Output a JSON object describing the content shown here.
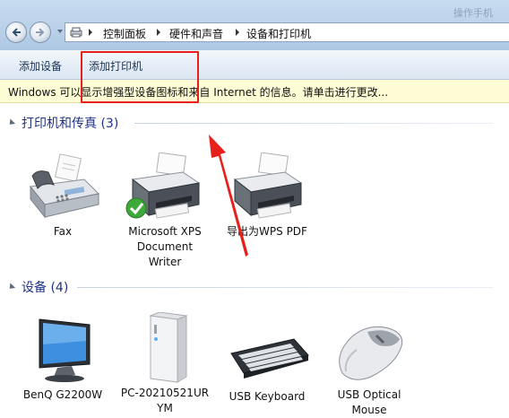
{
  "window": {
    "title": "操作手机"
  },
  "address": {
    "crumbs": [
      "控制面板",
      "硬件和声音",
      "设备和打印机"
    ]
  },
  "toolbar": {
    "add_device": "添加设备",
    "add_printer": "添加打印机"
  },
  "infobar": {
    "message": "Windows 可以显示增强型设备图标和来自 Internet 的信息。请单击进行更改..."
  },
  "groups": {
    "printers": {
      "title": "打印机和传真 (3)",
      "items": [
        {
          "label1": "Fax",
          "label2": "",
          "label3": "",
          "icon": "fax-icon"
        },
        {
          "label1": "Microsoft XPS",
          "label2": "Document",
          "label3": "Writer",
          "icon": "printer-icon",
          "default": true
        },
        {
          "label1": "导出为WPS PDF",
          "label2": "",
          "label3": "",
          "icon": "printer-icon"
        }
      ]
    },
    "devices": {
      "title": "设备 (4)",
      "items": [
        {
          "label1": "BenQ G2200W",
          "label2": "",
          "icon": "monitor-icon"
        },
        {
          "label1": "PC-20210521UR",
          "label2": "YM",
          "icon": "computer-tower-icon"
        },
        {
          "label1": "USB Keyboard",
          "label2": "",
          "icon": "keyboard-icon"
        },
        {
          "label1": "USB Optical",
          "label2": "Mouse",
          "icon": "mouse-icon"
        }
      ]
    }
  },
  "colors": {
    "highlight": "#e8201c",
    "group_title": "#1e3287",
    "infobar_bg": "#fefcd5"
  }
}
